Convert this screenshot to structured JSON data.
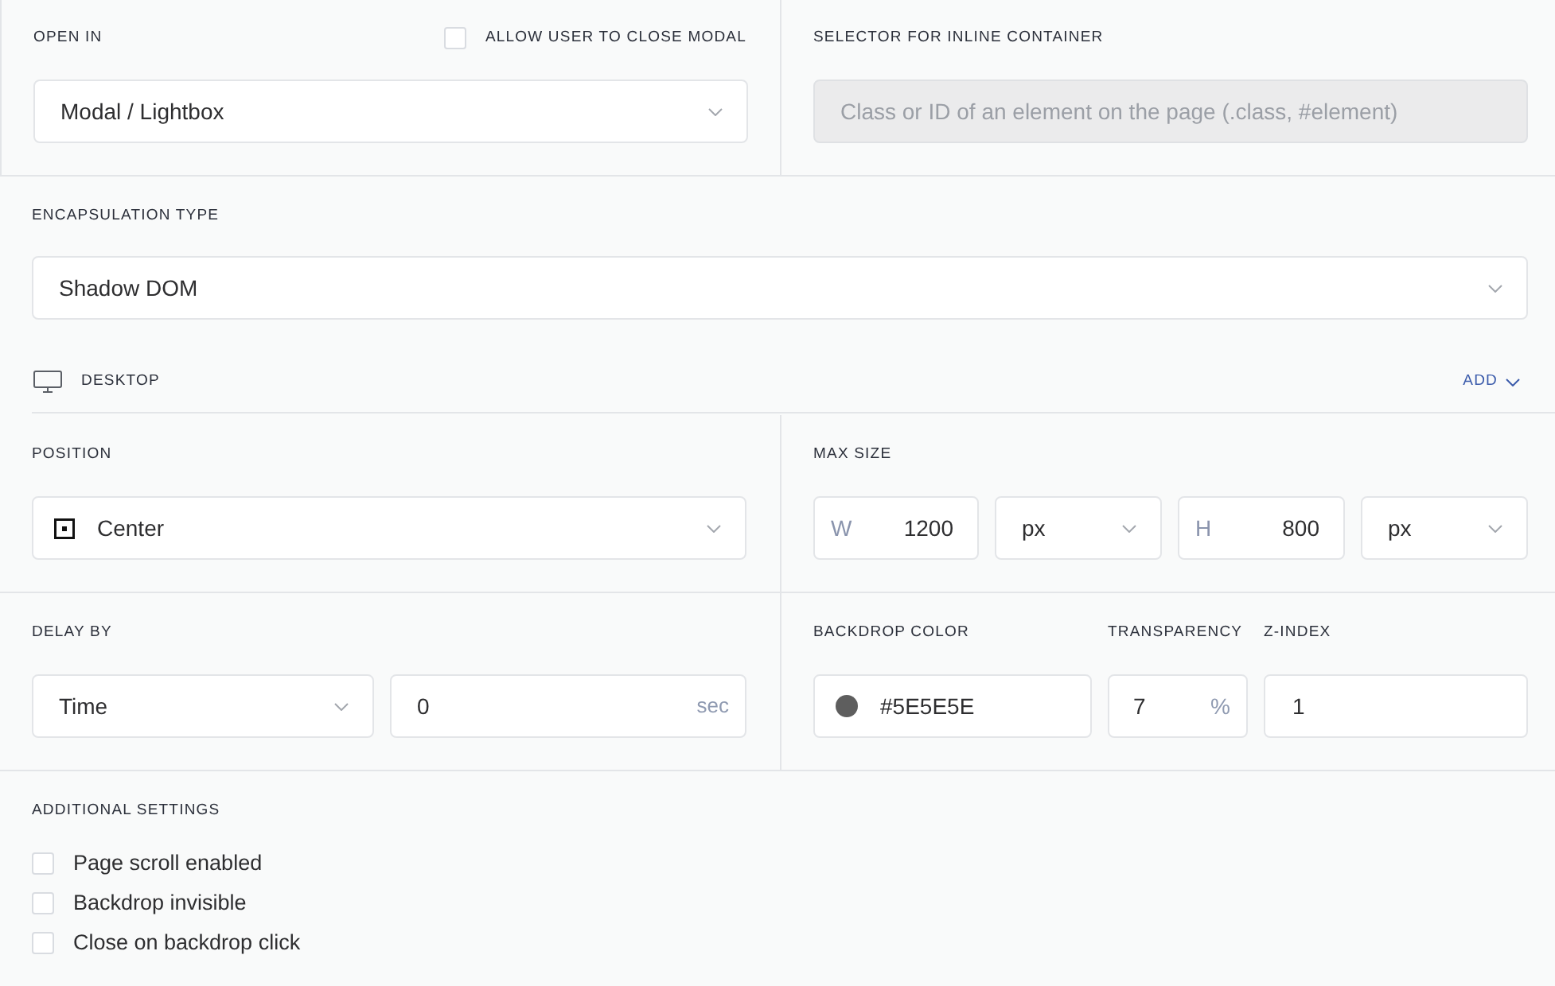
{
  "open_in": {
    "label": "OPEN IN",
    "allow_close": {
      "label": "ALLOW USER TO CLOSE MODAL",
      "checked": false
    },
    "select": {
      "value": "Modal / Lightbox"
    }
  },
  "inline_selector": {
    "label": "SELECTOR FOR INLINE CONTAINER",
    "placeholder": "Class or ID of an element on the page (.class, #element)",
    "disabled": true
  },
  "encapsulation": {
    "label": "ENCAPSULATION TYPE",
    "select": {
      "value": "Shadow DOM"
    }
  },
  "device": {
    "label": "DESKTOP",
    "add_button": "ADD"
  },
  "position": {
    "label": "POSITION",
    "select": {
      "value": "Center"
    }
  },
  "max_size": {
    "label": "MAX SIZE",
    "width": {
      "prefix": "W",
      "value": "1200",
      "unit": "px"
    },
    "height": {
      "prefix": "H",
      "value": "800",
      "unit": "px"
    }
  },
  "delay": {
    "label": "DELAY BY",
    "select": {
      "value": "Time"
    },
    "input": {
      "value": "0",
      "suffix": "sec"
    }
  },
  "backdrop_color": {
    "label": "BACKDROP COLOR",
    "value": "#5E5E5E",
    "color": "#5e5e5e"
  },
  "transparency": {
    "label": "TRANSPARENCY",
    "value": "7",
    "suffix": "%"
  },
  "z_index": {
    "label": "Z-INDEX",
    "value": "1"
  },
  "additional_settings": {
    "label": "ADDITIONAL SETTINGS",
    "options": [
      {
        "label": "Page scroll enabled",
        "checked": false
      },
      {
        "label": "Backdrop invisible",
        "checked": false
      },
      {
        "label": "Close on backdrop click",
        "checked": false
      }
    ]
  }
}
